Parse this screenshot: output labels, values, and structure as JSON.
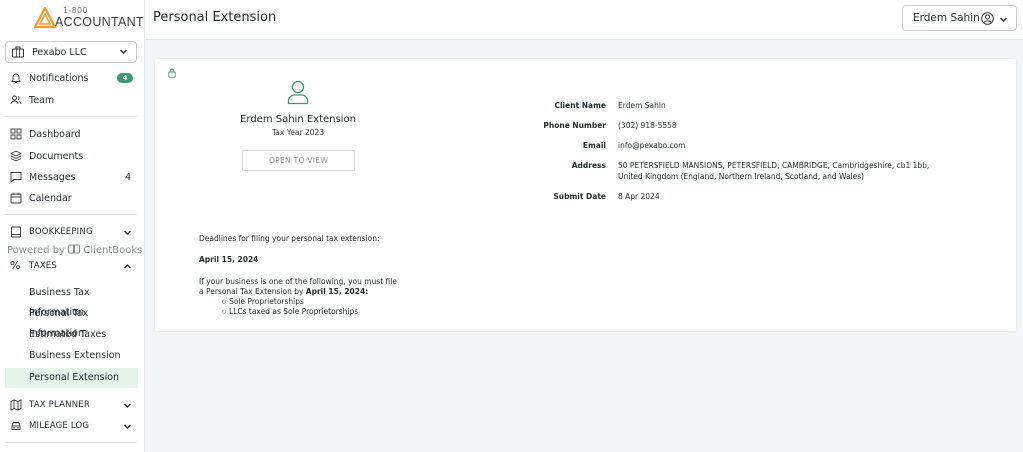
{
  "logo": {
    "small": "1-800",
    "big": "ACCOUNTANT"
  },
  "company_selector": {
    "label": "Pexabo LLC"
  },
  "nav": {
    "notifications": {
      "label": "Notifications",
      "count": "4"
    },
    "team": {
      "label": "Team"
    },
    "dashboard": {
      "label": "Dashboard"
    },
    "documents": {
      "label": "Documents"
    },
    "messages": {
      "label": "Messages",
      "count": "4"
    },
    "calendar": {
      "label": "Calendar"
    },
    "bookkeeping": {
      "label": "BOOKKEEPING",
      "powered_by": "Powered by",
      "powered_brand": "ClientBooks"
    },
    "taxes": {
      "label": "TAXES",
      "items": [
        {
          "label": "Business Tax Information"
        },
        {
          "label": "Personal Tax Information"
        },
        {
          "label": "Estimated Taxes"
        },
        {
          "label": "Business Extension"
        },
        {
          "label": "Personal Extension"
        }
      ]
    },
    "tax_planner": {
      "label": "TAX PLANNER"
    },
    "mileage_log": {
      "label": "MILEAGE LOG"
    }
  },
  "header": {
    "title": "Personal Extension",
    "user": "Erdem Sahin"
  },
  "extension": {
    "title": "Erdem Sahin Extension",
    "tax_year": "Tax Year 2023",
    "open_button": "OPEN TO VIEW"
  },
  "client_info": {
    "rows": [
      {
        "label": "Client Name",
        "value": "Erdem Sahin"
      },
      {
        "label": "Phone Number",
        "value": "(302) 918-5558"
      },
      {
        "label": "Email",
        "value": "info@pexabo.com"
      },
      {
        "label": "Address",
        "value": "50 PETERSFIELD MANSIONS, PETERSFIELD, CAMBRIDGE, Cambridgeshire, cb1 1bb,",
        "value2": "United Kingdom (England, Northern Ireland, Scotland, and Wales)"
      },
      {
        "label": "Submit Date",
        "value": "8 Apr 2024"
      }
    ]
  },
  "deadlines": {
    "intro": "Deadlines for filing your personal tax extension:",
    "date": "April 15, 2024",
    "line1": "If your business is one of the following, you must file",
    "line2_prefix": "a Personal Tax Extension by ",
    "line2_bold": "April 15, 2024:",
    "bullets": [
      "Sole Proprietorships",
      "LLCs taxed as Sole Proprietorships"
    ]
  },
  "colors": {
    "accent": "#3e9a76",
    "logo_orange": "#f39a2b",
    "active_bg": "#e4f4ea"
  }
}
